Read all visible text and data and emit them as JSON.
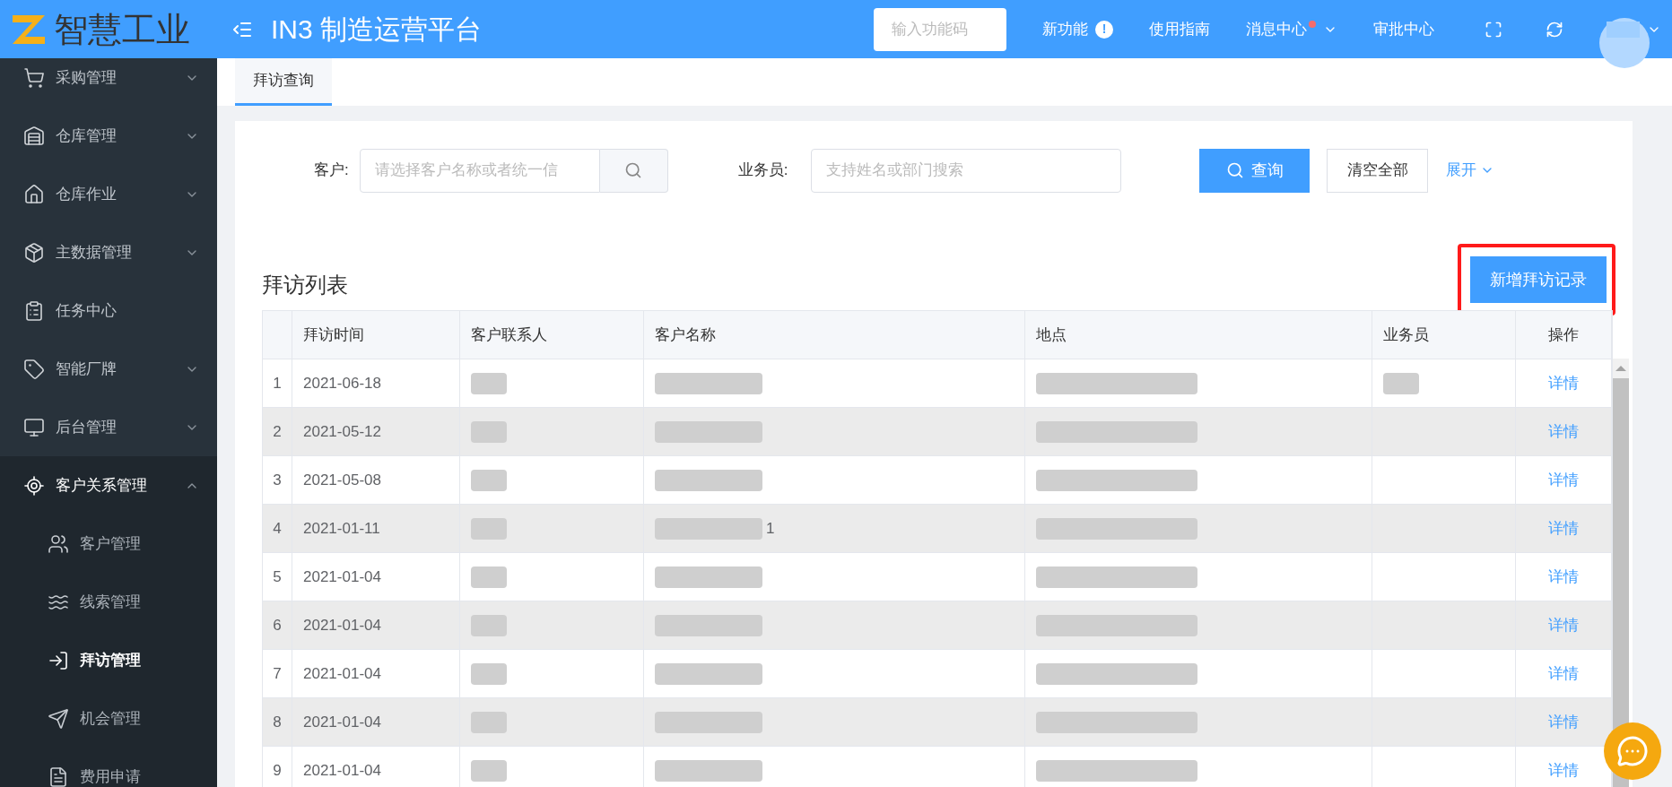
{
  "header": {
    "logo_text": "智慧工业",
    "title": "IN3 制造运营平台",
    "function_code": {
      "placeholder": "输入功能码"
    },
    "nav": [
      {
        "kind": "alert",
        "label": "新功能",
        "badge": "!"
      },
      {
        "kind": "plain",
        "label": "使用指南"
      },
      {
        "kind": "dropdown",
        "label": "消息中心",
        "unread": true
      },
      {
        "kind": "plain",
        "label": "审批中心"
      }
    ]
  },
  "sidebar": {
    "items": [
      {
        "label": "采购管理",
        "expanded": false,
        "has_children": true
      },
      {
        "label": "仓库管理",
        "expanded": false,
        "has_children": true
      },
      {
        "label": "仓库作业",
        "expanded": false,
        "has_children": true
      },
      {
        "label": "主数据管理",
        "expanded": false,
        "has_children": true
      },
      {
        "label": "任务中心",
        "expanded": false,
        "has_children": false
      },
      {
        "label": "智能厂牌",
        "expanded": false,
        "has_children": true
      },
      {
        "label": "后台管理",
        "expanded": false,
        "has_children": true
      },
      {
        "label": "客户关系管理",
        "expanded": true,
        "has_children": true,
        "children": [
          {
            "label": "客户管理",
            "selected": false
          },
          {
            "label": "线索管理",
            "selected": false
          },
          {
            "label": "拜访管理",
            "selected": true
          },
          {
            "label": "机会管理",
            "selected": false
          },
          {
            "label": "费用申请",
            "selected": false
          }
        ]
      }
    ]
  },
  "tabs": [
    {
      "label": "拜访查询",
      "selected": true
    }
  ],
  "filters": {
    "customer": {
      "label": "客户:",
      "placeholder": "请选择客户名称或者统一信"
    },
    "salesman": {
      "label": "业务员:",
      "placeholder": "支持姓名或部门搜索"
    },
    "search_button": "查询",
    "clear_button": "清空全部",
    "expand_link": "展开"
  },
  "list": {
    "title": "拜访列表",
    "add_button": {
      "label": "新增拜访记录",
      "highlighted": true
    },
    "columns": [
      "拜访时间",
      "客户联系人",
      "客户名称",
      "地点",
      "业务员",
      "操作"
    ],
    "rows": [
      {
        "index": "1",
        "time": "2021-06-18",
        "contact": {
          "redacted": true
        },
        "name": {
          "redacted": true
        },
        "location": {
          "redacted": true
        },
        "salesman": {
          "redacted": true
        },
        "action": "详情"
      },
      {
        "index": "2",
        "time": "2021-05-12",
        "contact": {
          "redacted": true
        },
        "name": {
          "redacted": true
        },
        "location": {
          "redacted": true
        },
        "salesman": {
          "redacted": false
        },
        "action": "详情"
      },
      {
        "index": "3",
        "time": "2021-05-08",
        "contact": {
          "redacted": true
        },
        "name": {
          "redacted": true
        },
        "location": {
          "redacted": true
        },
        "salesman": {
          "redacted": false
        },
        "action": "详情"
      },
      {
        "index": "4",
        "time": "2021-01-11",
        "contact": {
          "redacted": true
        },
        "name": {
          "redacted": true,
          "text": "1"
        },
        "location": {
          "redacted": true
        },
        "salesman": {
          "redacted": false
        },
        "action": "详情"
      },
      {
        "index": "5",
        "time": "2021-01-04",
        "contact": {
          "redacted": true
        },
        "name": {
          "redacted": true
        },
        "location": {
          "redacted": true
        },
        "salesman": {
          "redacted": false
        },
        "action": "详情"
      },
      {
        "index": "6",
        "time": "2021-01-04",
        "contact": {
          "redacted": true
        },
        "name": {
          "redacted": true
        },
        "location": {
          "redacted": true
        },
        "salesman": {
          "redacted": false
        },
        "action": "详情"
      },
      {
        "index": "7",
        "time": "2021-01-04",
        "contact": {
          "redacted": true
        },
        "name": {
          "redacted": true
        },
        "location": {
          "redacted": true
        },
        "salesman": {
          "redacted": false
        },
        "action": "详情"
      },
      {
        "index": "8",
        "time": "2021-01-04",
        "contact": {
          "redacted": true
        },
        "name": {
          "redacted": true
        },
        "location": {
          "redacted": true
        },
        "salesman": {
          "redacted": false
        },
        "action": "详情"
      },
      {
        "index": "9",
        "time": "2021-01-04",
        "contact": {
          "redacted": true
        },
        "name": {
          "redacted": true
        },
        "location": {
          "redacted": true
        },
        "salesman": {
          "redacted": false
        },
        "action": "详情"
      }
    ]
  }
}
